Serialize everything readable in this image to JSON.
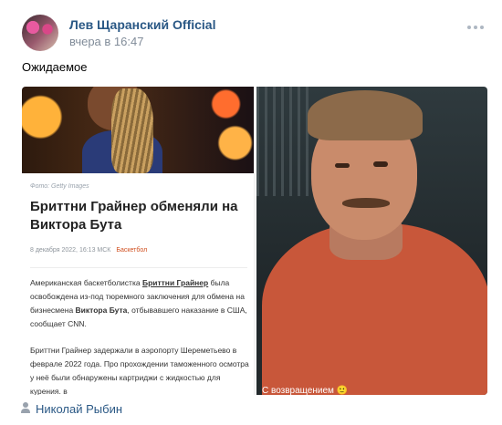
{
  "post": {
    "author": "Лев Щаранский Official",
    "time": "вчера в 16:47",
    "text": "Ожидаемое"
  },
  "article": {
    "photo_caption": "Фото: Getty Images",
    "headline": "Бриттни Грайнер обменяли на Виктора Бута",
    "date": "8 декабря 2022, 16:13 МСК",
    "category": "Баскетбол",
    "p1_before": "Американская баскетболистка ",
    "p1_link": "Бриттни Грайнер",
    "p1_middle": " была освобождена из-под тюремного заключения для обмена на бизнесмена ",
    "p1_bold": "Виктора Бута",
    "p1_after": ", отбывавшего наказание в США, сообщает CNN.",
    "p2": "Бриттни Грайнер задержали в аэропорту Шереметьево в феврале 2022 года. Про прохождении таможенного осмотра у неё были обнаружены картриджи с жидкостью для курения. в"
  },
  "portrait": {
    "caption": "С возвращением 🙂"
  },
  "comment_prompt": {
    "name": "Николай Рыбин"
  },
  "icons": {
    "more": "more-dots-icon",
    "user": "user-icon"
  },
  "colors": {
    "link": "#2a5885",
    "meta": "#818c99",
    "category": "#d04e1e"
  }
}
